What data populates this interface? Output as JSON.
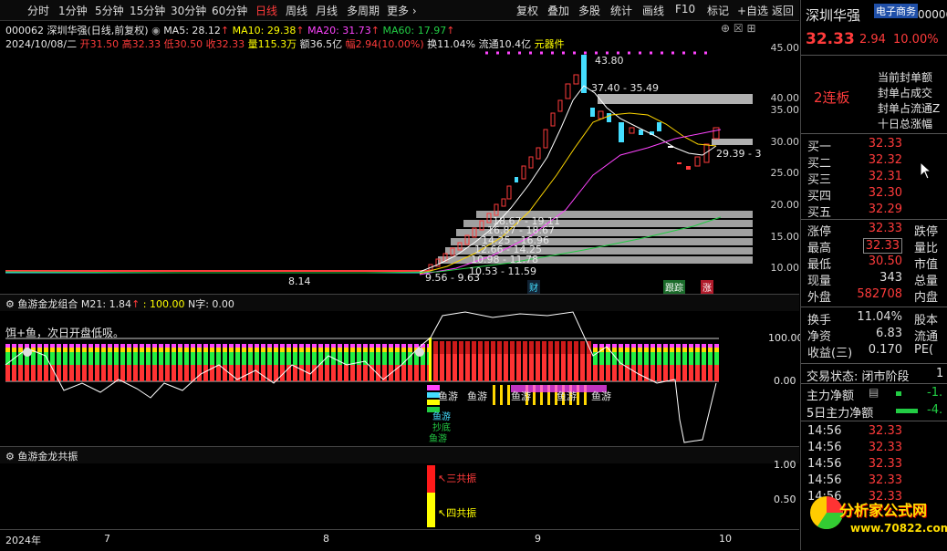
{
  "toolbar": {
    "periods": [
      "分时",
      "1分钟",
      "5分钟",
      "15分钟",
      "30分钟",
      "60分钟",
      "日线",
      "周线",
      "月线",
      "多周期"
    ],
    "more": "更多",
    "right_items": [
      "复权",
      "叠加",
      "多股",
      "统计",
      "画线",
      "F10",
      "标记",
      "+自选",
      "返回"
    ]
  },
  "info1": {
    "code": "000062 深圳华强(日线,前复权)",
    "ma5": "MA5: 28.12",
    "ma10": "MA10: 29.38",
    "ma20": "MA20: 31.73",
    "ma60": "MA60: 17.97"
  },
  "info2": {
    "date": "2024/10/08/二",
    "open": "开31.50",
    "high": "高32.33",
    "low": "低30.50",
    "close": "收32.33",
    "vol": "量115.3万",
    "amount": "额36.5亿",
    "change": "幅2.94(10.00%)",
    "turnover": "换11.04%",
    "float": "流通10.4亿",
    "sector": "元器件"
  },
  "price_axis": [
    "45.00",
    "40.00",
    "35.00",
    "30.00",
    "25.00",
    "20.00",
    "15.00",
    "10.00"
  ],
  "price_annotations": {
    "peak": "43.80",
    "range1": "37.40 - 35.49",
    "range2": "29.39 - 3",
    "low_mark": "8.14",
    "base": "9.56 - 9.63",
    "r1": "18.67 - 19.11",
    "r2": "16.87 - 18.67",
    "r3": "14.25 - 16.96",
    "r4": "12.66 - 14.25",
    "r5": "10.98 - 11.78",
    "r6": "10.53 - 11.59"
  },
  "event_badges": {
    "cai": "财",
    "gen": "跟踪",
    "zhang": "涨"
  },
  "indicator1": {
    "name": "鱼游金龙组合",
    "m21": "M21: 1.84",
    "val": ": 100.00",
    "n": "N字: 0.00",
    "note": "饵+鱼，次日开盘低吸。",
    "axis": [
      "100.00",
      "0.00"
    ],
    "labels": [
      "鱼游",
      "鱼游",
      "鱼游",
      "鱼游",
      "鱼游"
    ],
    "small": [
      "鱼游",
      "抄底",
      "鱼游"
    ]
  },
  "indicator2": {
    "name": "鱼游金龙共振",
    "axis": [
      "1.00",
      "0.50"
    ],
    "tag3": "三共振",
    "tag4": "四共振"
  },
  "date_axis": [
    "2024年",
    "7",
    "8",
    "9",
    "10"
  ],
  "rightpanel": {
    "stock": "深圳华强",
    "sector": "电子商务",
    "code": "00006",
    "price": "32.33",
    "change": "2.94",
    "pct": "10.00%",
    "lianban": "2连板",
    "seal_labels": [
      "当前封单额",
      "封单占成交",
      "封单占流通Z",
      "十日总涨幅"
    ],
    "bids": [
      {
        "label": "买一",
        "price": "32.33"
      },
      {
        "label": "买二",
        "price": "32.32"
      },
      {
        "label": "买三",
        "price": "32.31"
      },
      {
        "label": "买四",
        "price": "32.30"
      },
      {
        "label": "买五",
        "price": "32.29"
      }
    ],
    "stats": [
      {
        "label": "涨停",
        "value": "32.33",
        "x": "跌停"
      },
      {
        "label": "最高",
        "value": "32.33",
        "x": "量比"
      },
      {
        "label": "最低",
        "value": "30.50",
        "x": "市值"
      },
      {
        "label": "现量",
        "value": "343",
        "x": "总量"
      },
      {
        "label": "外盘",
        "value": "582708",
        "x": "内盘"
      }
    ],
    "stats2": [
      {
        "label": "换手",
        "value": "11.04%",
        "x": "股本"
      },
      {
        "label": "净资",
        "value": "6.83",
        "x": "流通"
      },
      {
        "label": "收益(三)",
        "value": "0.170",
        "x": "PE("
      }
    ],
    "status": "交易状态: 闭市阶段",
    "status_num": "1",
    "main_net": "主力净额",
    "main_net_val": "-1.",
    "main5": "5日主力净额",
    "main5_val": "-4.",
    "ticks": [
      {
        "time": "14:56",
        "price": "32.33"
      },
      {
        "time": "14:56",
        "price": "32.33"
      },
      {
        "time": "14:56",
        "price": "32.33"
      },
      {
        "time": "14:56",
        "price": "32.33"
      },
      {
        "time": "14:56",
        "price": "32.33"
      }
    ],
    "logo_text": "分析家公式网",
    "logo_url": "www.70822.com"
  },
  "colors": {
    "up": "#ff3b3b",
    "down": "#44ddff",
    "ma5": "#ffffff",
    "ma10": "#ffd700",
    "ma20": "#ff44ff",
    "ma60": "#22cc44"
  }
}
